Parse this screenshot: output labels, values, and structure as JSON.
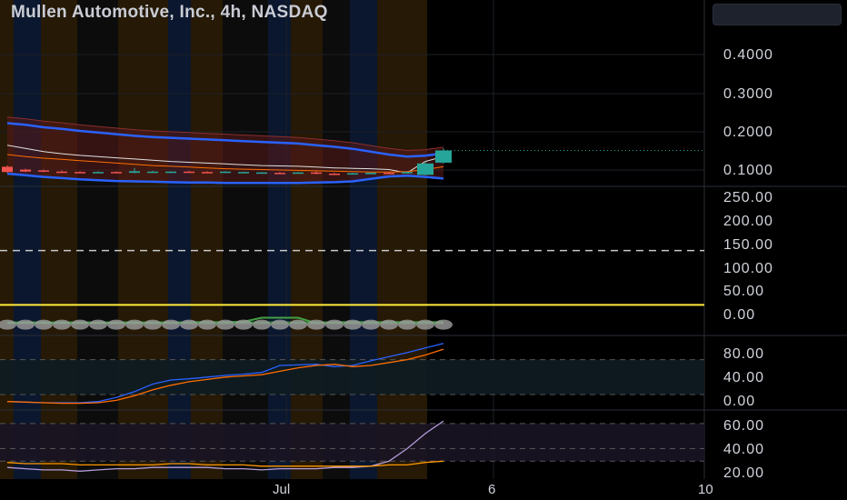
{
  "header": {
    "title": "Mullen Automotive, Inc., 4h, NASDAQ"
  },
  "price_axis": [
    "0.4000",
    "0.3000",
    "0.2000",
    "0.1000"
  ],
  "volume_axis": [
    "250.00",
    "200.00",
    "150.00",
    "100.00",
    "50.00",
    "0.00"
  ],
  "rsi_axis": [
    "80.00",
    "40.00",
    "0.00"
  ],
  "adx_axis": [
    "60.00",
    "40.00",
    "20.00"
  ],
  "time_axis": [
    "Jul",
    "6",
    "10"
  ],
  "colors": {
    "background": "#000000",
    "up_candle": "#26a69a",
    "down_candle": "#ef5350",
    "bollinger": "#2962ff",
    "ema_orange": "#ff6d00",
    "sma_white": "#e0e0e0",
    "yellow_level": "#ffeb3b",
    "green_line": "#43a047",
    "purple_line": "#b39ddb"
  },
  "chart_data": [
    {
      "type": "candlestick",
      "panel": "price",
      "title": "Mullen Automotive, Inc., 4h, NASDAQ",
      "ylim": [
        0.07,
        0.45
      ],
      "x_labels": [
        "Jul",
        "6",
        "10"
      ],
      "candles": [
        {
          "o": 0.125,
          "h": 0.128,
          "l": 0.11,
          "c": 0.112
        },
        {
          "o": 0.118,
          "h": 0.12,
          "l": 0.112,
          "c": 0.113
        },
        {
          "o": 0.116,
          "h": 0.118,
          "l": 0.112,
          "c": 0.113
        },
        {
          "o": 0.113,
          "h": 0.116,
          "l": 0.111,
          "c": 0.112
        },
        {
          "o": 0.112,
          "h": 0.114,
          "l": 0.11,
          "c": 0.111
        },
        {
          "o": 0.111,
          "h": 0.114,
          "l": 0.109,
          "c": 0.112
        },
        {
          "o": 0.112,
          "h": 0.114,
          "l": 0.11,
          "c": 0.111
        },
        {
          "o": 0.11,
          "h": 0.122,
          "l": 0.109,
          "c": 0.114
        },
        {
          "o": 0.112,
          "h": 0.115,
          "l": 0.11,
          "c": 0.113
        },
        {
          "o": 0.111,
          "h": 0.114,
          "l": 0.11,
          "c": 0.113
        },
        {
          "o": 0.113,
          "h": 0.115,
          "l": 0.111,
          "c": 0.112
        },
        {
          "o": 0.112,
          "h": 0.114,
          "l": 0.11,
          "c": 0.111
        },
        {
          "o": 0.11,
          "h": 0.114,
          "l": 0.109,
          "c": 0.113
        },
        {
          "o": 0.111,
          "h": 0.113,
          "l": 0.11,
          "c": 0.112
        },
        {
          "o": 0.11,
          "h": 0.112,
          "l": 0.109,
          "c": 0.111
        },
        {
          "o": 0.11,
          "h": 0.112,
          "l": 0.108,
          "c": 0.109
        },
        {
          "o": 0.109,
          "h": 0.112,
          "l": 0.108,
          "c": 0.111
        },
        {
          "o": 0.111,
          "h": 0.115,
          "l": 0.106,
          "c": 0.108
        },
        {
          "o": 0.108,
          "h": 0.11,
          "l": 0.106,
          "c": 0.107
        },
        {
          "o": 0.108,
          "h": 0.11,
          "l": 0.107,
          "c": 0.109
        },
        {
          "o": 0.109,
          "h": 0.111,
          "l": 0.108,
          "c": 0.11
        },
        {
          "o": 0.11,
          "h": 0.112,
          "l": 0.108,
          "c": 0.109
        },
        {
          "o": 0.109,
          "h": 0.113,
          "l": 0.108,
          "c": 0.112
        },
        {
          "o": 0.105,
          "h": 0.138,
          "l": 0.104,
          "c": 0.133
        },
        {
          "o": 0.135,
          "h": 0.17,
          "l": 0.133,
          "c": 0.165
        }
      ],
      "bollinger_upper": [
        0.232,
        0.228,
        0.222,
        0.218,
        0.213,
        0.209,
        0.205,
        0.201,
        0.198,
        0.196,
        0.194,
        0.192,
        0.19,
        0.188,
        0.186,
        0.184,
        0.182,
        0.178,
        0.174,
        0.169,
        0.162,
        0.155,
        0.15,
        0.152,
        0.158
      ],
      "bollinger_lower": [
        0.108,
        0.104,
        0.1,
        0.097,
        0.094,
        0.092,
        0.09,
        0.089,
        0.088,
        0.087,
        0.086,
        0.086,
        0.085,
        0.085,
        0.085,
        0.085,
        0.085,
        0.086,
        0.087,
        0.089,
        0.095,
        0.101,
        0.103,
        0.1,
        0.096
      ],
      "ema": [
        0.155,
        0.15,
        0.146,
        0.143,
        0.14,
        0.137,
        0.134,
        0.131,
        0.128,
        0.126,
        0.124,
        0.122,
        0.12,
        0.119,
        0.118,
        0.117,
        0.116,
        0.115,
        0.114,
        0.113,
        0.112,
        0.112,
        0.113,
        0.118,
        0.125
      ],
      "sma": [
        0.178,
        0.17,
        0.162,
        0.157,
        0.153,
        0.15,
        0.147,
        0.144,
        0.141,
        0.138,
        0.136,
        0.134,
        0.132,
        0.13,
        0.128,
        0.127,
        0.126,
        0.124,
        0.122,
        0.121,
        0.12,
        0.118,
        0.11,
        0.138,
        0.15
      ],
      "last_price": 0.165
    },
    {
      "type": "line",
      "panel": "volume_indicator",
      "ylim": [
        -20,
        280
      ],
      "levels": [
        150,
        40
      ],
      "series": [
        {
          "values": [
            4,
            4,
            4,
            4,
            4,
            4,
            4,
            4,
            4,
            4,
            4,
            4,
            4,
            4,
            4,
            4,
            4,
            4,
            4,
            4,
            4,
            4,
            4,
            4,
            4
          ]
        },
        {
          "values": [
            4,
            4,
            4,
            4,
            4,
            4,
            4,
            4,
            4,
            4,
            5,
            5,
            5,
            6,
            14,
            14,
            14,
            3,
            5,
            5,
            5,
            5,
            5,
            5,
            5
          ]
        }
      ],
      "dots_value": 0,
      "dots_count": 25
    },
    {
      "type": "line",
      "panel": "stochastic",
      "ylim": [
        -5,
        120
      ],
      "band": [
        20,
        80
      ],
      "series": [
        {
          "values": [
            8,
            7,
            6,
            6,
            6,
            8,
            15,
            25,
            38,
            45,
            47,
            50,
            53,
            55,
            58,
            70,
            71,
            72,
            68,
            70,
            78,
            85,
            92,
            100,
            108
          ]
        },
        {
          "values": [
            8,
            7,
            6,
            5,
            5,
            6,
            10,
            18,
            28,
            36,
            42,
            46,
            50,
            52,
            54,
            60,
            66,
            70,
            72,
            68,
            70,
            75,
            80,
            88,
            98
          ]
        }
      ]
    },
    {
      "type": "line",
      "panel": "adx",
      "ylim": [
        15,
        70
      ],
      "band": [
        30,
        60
      ],
      "series": [
        {
          "values": [
            25,
            24,
            23,
            23,
            22,
            23,
            24,
            24,
            25,
            25,
            25,
            25,
            24,
            24,
            23,
            24,
            24,
            24,
            25,
            25,
            26,
            30,
            40,
            52,
            62
          ]
        },
        {
          "values": [
            29,
            28,
            28,
            28,
            27,
            27,
            27,
            27,
            27,
            28,
            28,
            27,
            27,
            27,
            26,
            26,
            26,
            26,
            26,
            26,
            26,
            27,
            27,
            29,
            30
          ]
        }
      ]
    }
  ]
}
